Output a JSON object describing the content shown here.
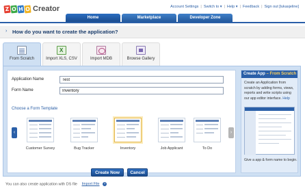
{
  "brand": {
    "logo_letters": [
      "Z",
      "O",
      "H",
      "O"
    ],
    "product": "Creator"
  },
  "toplinks": {
    "account_settings": "Account Settings",
    "switch_to": "Switch to",
    "help": "Help",
    "feedback": "Feedback",
    "sign_out": "Sign out [lukasjeline]"
  },
  "tabs": [
    {
      "label": "Home"
    },
    {
      "label": "Marketplace"
    },
    {
      "label": "Developer Zone"
    }
  ],
  "prompt": {
    "text": "How do you want to create the application?"
  },
  "options": [
    {
      "label": "From Scratch",
      "icon": "form-icon"
    },
    {
      "label": "Import XLS, CSV",
      "icon": "excel-icon"
    },
    {
      "label": "Import MDB",
      "icon": "database-icon"
    },
    {
      "label": "Browse Gallery",
      "icon": "gallery-icon"
    }
  ],
  "form": {
    "app_name_label": "Application Name",
    "app_name_value": "Test",
    "form_name_label": "Form Name",
    "form_name_value": "Inventory",
    "choose_template": "Choose a Form Template"
  },
  "templates": [
    {
      "label": "Customer Survey"
    },
    {
      "label": "Bug Tracker"
    },
    {
      "label": "Inventory"
    },
    {
      "label": "Job Applicant"
    },
    {
      "label": "To Do"
    }
  ],
  "buttons": {
    "create_now": "Create Now",
    "cancel": "Cancel"
  },
  "side": {
    "title_main": "Create App",
    "title_sep": " – ",
    "title_accent": "From Scratch",
    "body": "Create an Application from scratch by adding forms, views, reports and write scripts using our app editor interface.",
    "help_link": "Help",
    "footer": "Give a app & form name to begin."
  },
  "bottom": {
    "note": "You can also create application with DS file",
    "import_link": "Import File"
  },
  "colors": {
    "brand_blue": "#2a5fa8",
    "panel_blue": "#cfe0f3",
    "selected_gold": "#e3b64a"
  }
}
